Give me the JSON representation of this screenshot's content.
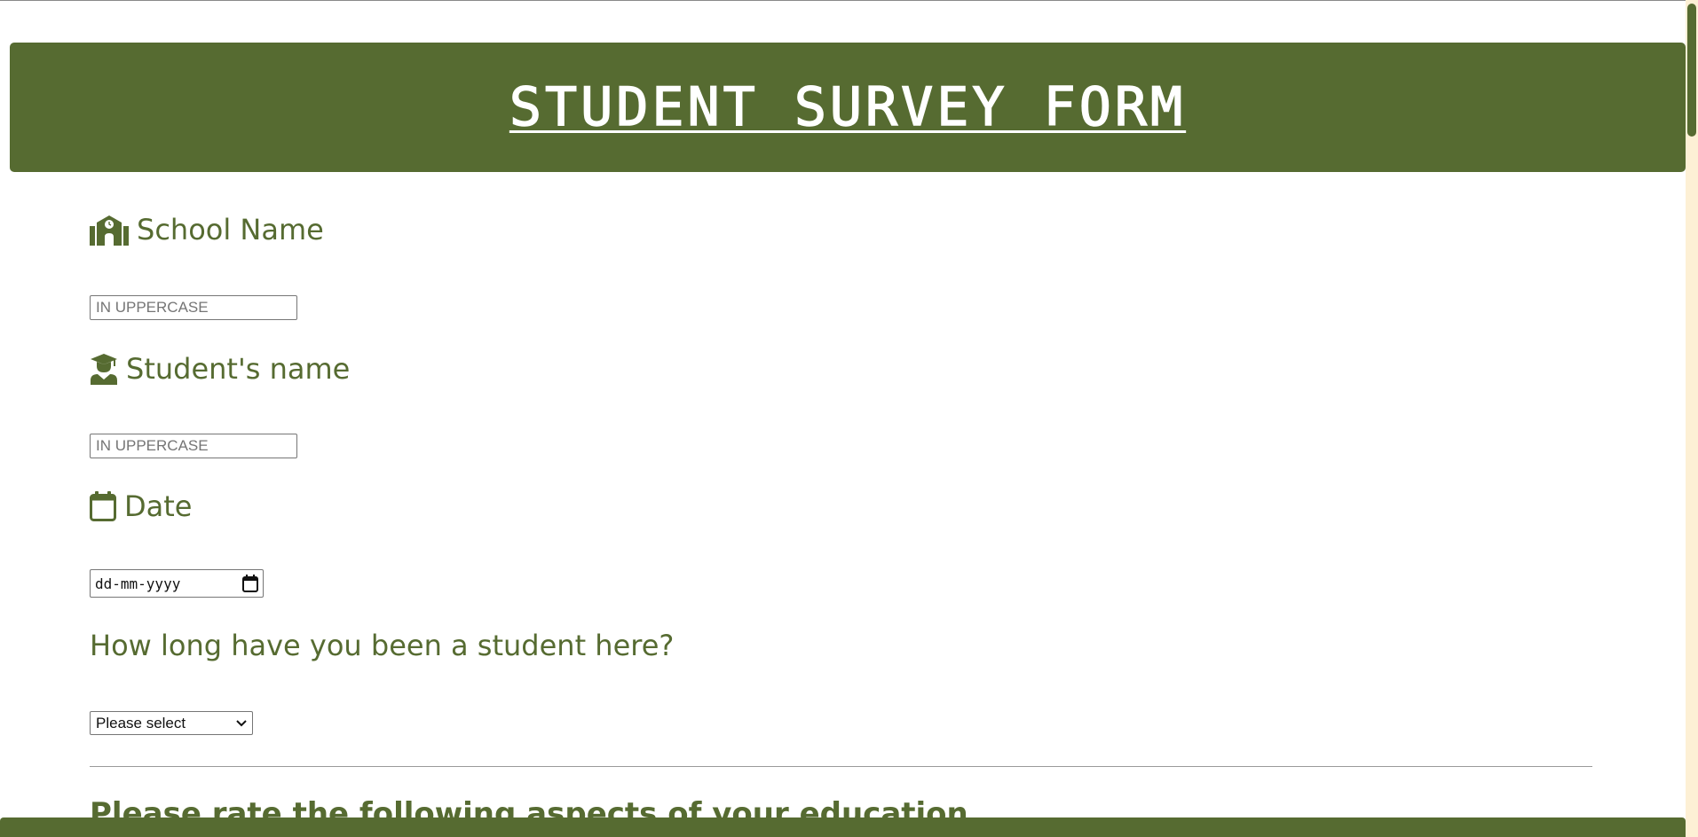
{
  "header": {
    "title": "STUDENT SURVEY FORM"
  },
  "fields": {
    "school_name": {
      "label": "School Name",
      "icon": "school-icon",
      "placeholder": "IN UPPERCASE",
      "value": ""
    },
    "student_name": {
      "label": "Student's name",
      "icon": "graduate-icon",
      "placeholder": "IN UPPERCASE",
      "value": ""
    },
    "date": {
      "label": "Date",
      "icon": "calendar-icon",
      "placeholder": "dd-mm-yyyy"
    },
    "duration": {
      "question": "How long have you been a student here?",
      "selected": "Please select"
    }
  },
  "rating_section": {
    "heading": "Please rate the following aspects of your education"
  },
  "colors": {
    "accent": "#566b31",
    "scrollbar_track": "#fdf0d5"
  }
}
